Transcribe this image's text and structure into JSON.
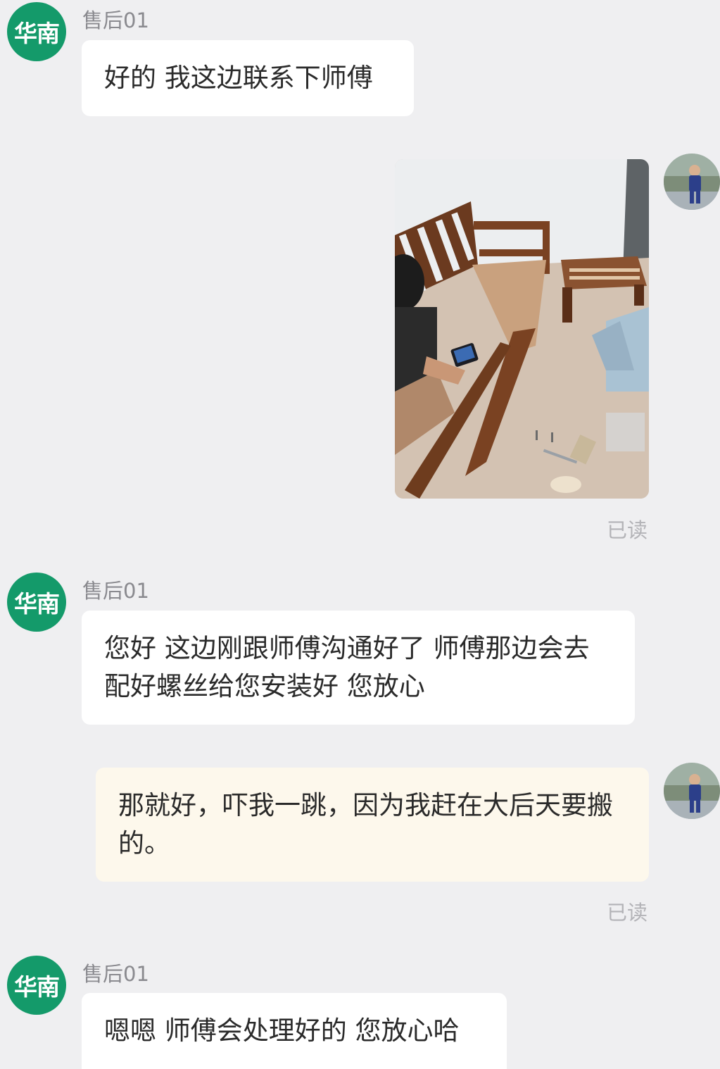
{
  "messages": [
    {
      "sender": "售后01",
      "avatar_text": "华南",
      "text": "好的 我这边联系下师傅"
    },
    {
      "from": "me",
      "kind": "image",
      "read": "已读"
    },
    {
      "sender": "售后01",
      "avatar_text": "华南",
      "text": "您好 这边刚跟师傅沟通好了 师傅那边会去配好螺丝给您安装好 您放心"
    },
    {
      "from": "me",
      "kind": "text",
      "text": "那就好，吓我一跳，因为我赶在大后天要搬的。",
      "read": "已读"
    },
    {
      "sender": "售后01",
      "avatar_text": "华南",
      "text": "嗯嗯 师傅会处理好的 您放心哈"
    }
  ],
  "colors": {
    "background": "#efeff1",
    "agent_avatar": "#149a6a",
    "my_bubble": "#fdf8ec",
    "agent_bubble": "#ffffff",
    "read_status": "#b3b3b7"
  },
  "icons": {
    "agent_avatar": "agent-avatar",
    "user_avatar": "user-avatar-photo"
  }
}
